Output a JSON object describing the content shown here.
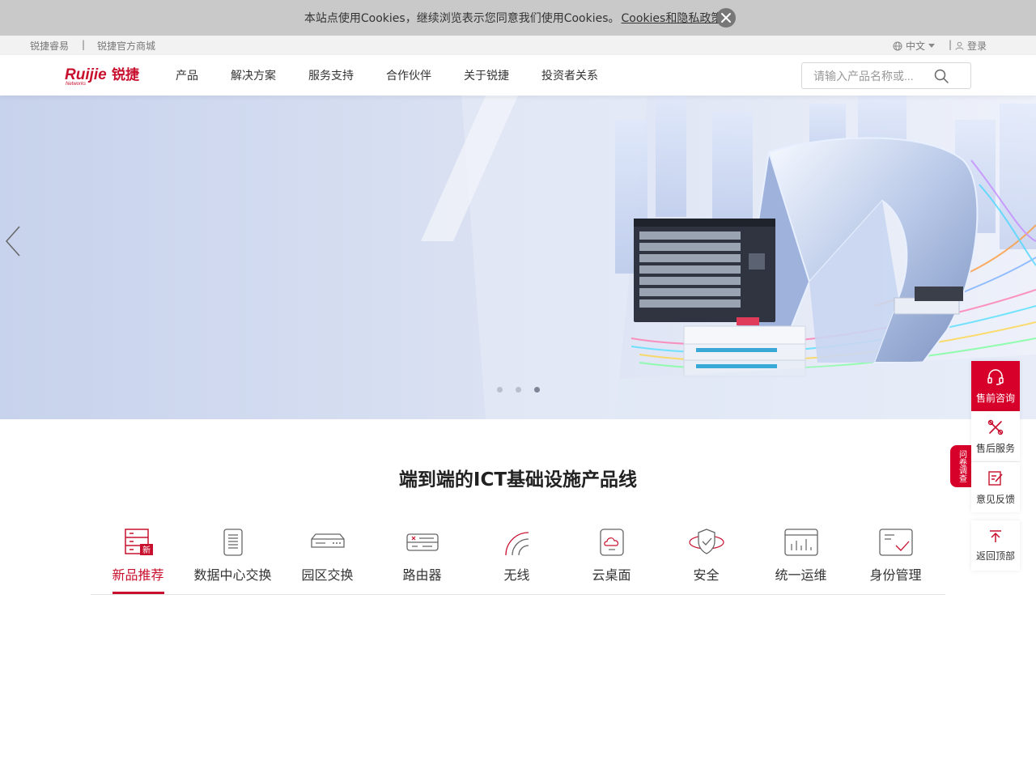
{
  "cookie": {
    "text": "本站点使用Cookies，继续浏览表示您同意我们使用Cookies。",
    "link": "Cookies和隐私政策>",
    "close_icon": "close-icon"
  },
  "util": {
    "link1": "锐捷睿易",
    "separator": "|",
    "link2": "锐捷官方商城",
    "language": "中文",
    "separator2": "|",
    "login": "登录"
  },
  "header": {
    "logo_text": "Ruijie锐捷",
    "logo_sub": "Networks",
    "nav": [
      "产品",
      "解决方案",
      "服务支持",
      "合作伙伴",
      "关于锐捷",
      "投资者关系"
    ],
    "search_placeholder": "请输入产品名称或..."
  },
  "banner": {
    "slides_count": 3,
    "active_slide": 3,
    "prev_icon": "chevron-left-icon"
  },
  "section": {
    "title": "端到端的ICT基础设施产品线",
    "tabs": [
      {
        "label": "新品推荐",
        "icon": "new-product-icon",
        "badge": "新",
        "active": true
      },
      {
        "label": "数据中心交换",
        "icon": "datacenter-switch-icon"
      },
      {
        "label": "园区交换",
        "icon": "campus-switch-icon"
      },
      {
        "label": "路由器",
        "icon": "router-icon"
      },
      {
        "label": "无线",
        "icon": "wireless-icon"
      },
      {
        "label": "云桌面",
        "icon": "cloud-desktop-icon"
      },
      {
        "label": "安全",
        "icon": "security-shield-icon"
      },
      {
        "label": "统一运维",
        "icon": "ops-monitor-icon"
      },
      {
        "label": "身份管理",
        "icon": "identity-icon"
      }
    ]
  },
  "tools": {
    "presale": "售前咨询",
    "aftersale": "售后服务",
    "feedback": "意见反馈",
    "backtop": "返回顶部",
    "side_tag": "问卷调查"
  },
  "colors": {
    "brand_red": "#c8102e",
    "tool_red": "#d6002a"
  }
}
